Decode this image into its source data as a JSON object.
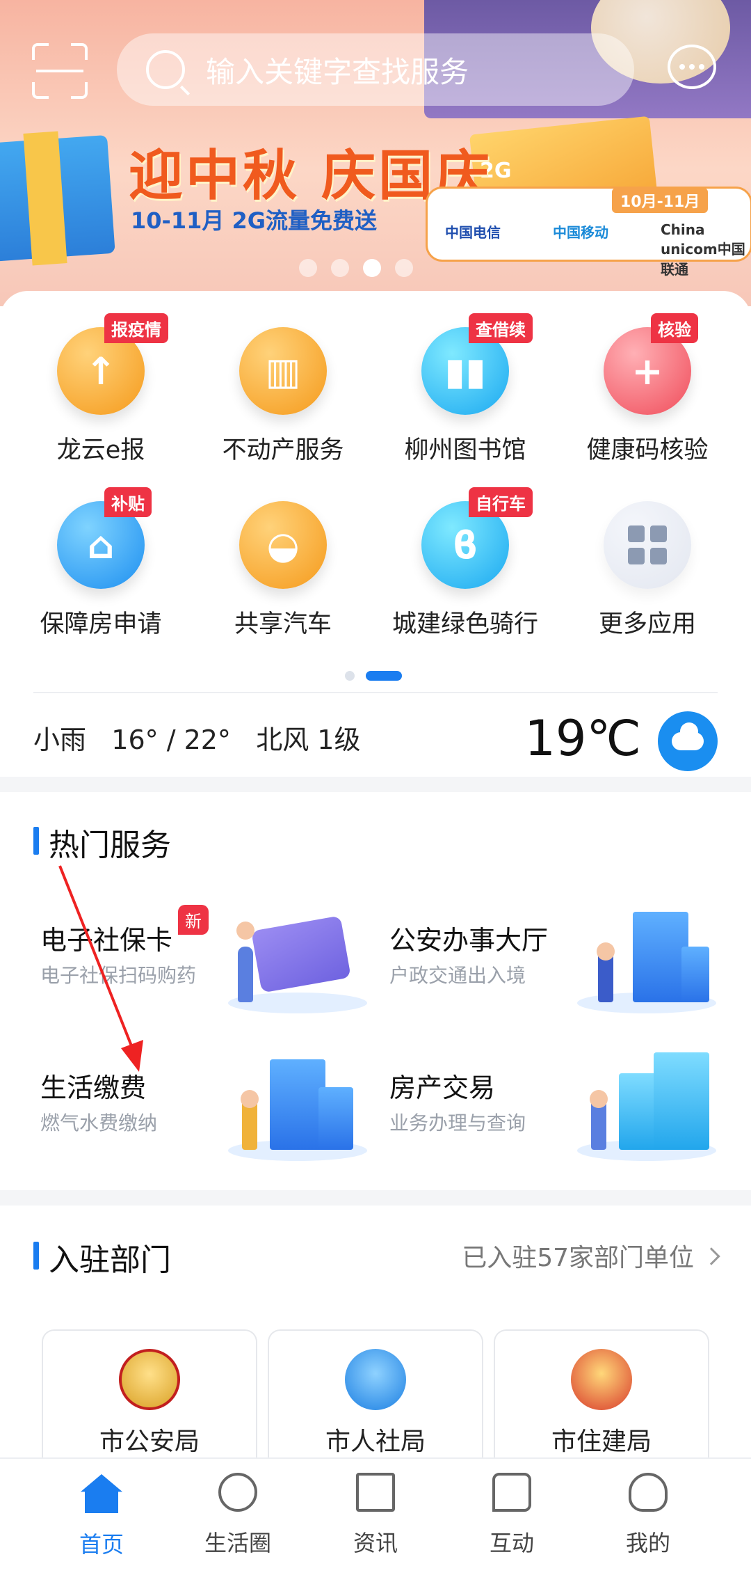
{
  "search": {
    "placeholder": "输入关键字查找服务"
  },
  "banner": {
    "headline": "迎中秋 庆国庆",
    "subline_prefix": "10-11月 ",
    "subline_highlight": "2G流量免费送",
    "coupon_text": "2G",
    "date_tag": "10月-11月",
    "carriers": [
      "中国电信",
      "中国移动",
      "China unicom中国联通"
    ],
    "slide_count": 4,
    "active_slide": 3
  },
  "grid": {
    "items": [
      {
        "label": "龙云e报",
        "badge": "报疫情",
        "icon": "report-icon",
        "color": "orange"
      },
      {
        "label": "不动产服务",
        "badge": "",
        "icon": "building-icon",
        "color": "orange"
      },
      {
        "label": "柳州图书馆",
        "badge": "查借续",
        "icon": "books-icon",
        "color": "cyan"
      },
      {
        "label": "健康码核验",
        "badge": "核验",
        "icon": "health-code-icon",
        "color": "red"
      },
      {
        "label": "保障房申请",
        "badge": "补贴",
        "icon": "house-hand-icon",
        "color": "blue"
      },
      {
        "label": "共享汽车",
        "badge": "",
        "icon": "car-icon",
        "color": "orange"
      },
      {
        "label": "城建绿色骑行",
        "badge": "自行车",
        "icon": "bike-icon",
        "color": "cyan"
      },
      {
        "label": "更多应用",
        "badge": "",
        "icon": "more-apps-icon",
        "color": "grey"
      }
    ],
    "page_count": 2,
    "active_page": 2
  },
  "weather": {
    "condition": "小雨",
    "range": "16° / 22°",
    "wind": "北风 1级",
    "temperature": "19℃",
    "icon": "rain-cloud-icon"
  },
  "hot_services": {
    "title": "热门服务",
    "items": [
      {
        "title": "电子社保卡",
        "subtitle": "电子社保扫码购药",
        "badge": "新"
      },
      {
        "title": "公安办事大厅",
        "subtitle": "户政交通出入境",
        "badge": ""
      },
      {
        "title": "生活缴费",
        "subtitle": "燃气水费缴纳",
        "badge": ""
      },
      {
        "title": "房产交易",
        "subtitle": "业务办理与查询",
        "badge": ""
      }
    ]
  },
  "departments": {
    "title": "入驻部门",
    "link": "已入驻57家部门单位",
    "items": [
      {
        "name": "市公安局",
        "icon": "police-emblem-icon"
      },
      {
        "name": "市人社局",
        "icon": "hr-logo-icon"
      },
      {
        "name": "市住建局",
        "icon": "national-emblem-icon"
      }
    ]
  },
  "tabbar": {
    "items": [
      {
        "label": "首页",
        "icon": "home-icon",
        "active": true
      },
      {
        "label": "生活圈",
        "icon": "planet-icon",
        "active": false
      },
      {
        "label": "资讯",
        "icon": "news-icon",
        "active": false
      },
      {
        "label": "互动",
        "icon": "chat-bubbles-icon",
        "active": false
      },
      {
        "label": "我的",
        "icon": "user-icon",
        "active": false
      }
    ]
  },
  "colors": {
    "accent": "#1a7df0",
    "badge": "#ee3344",
    "banner_headline": "#f05a1e"
  }
}
